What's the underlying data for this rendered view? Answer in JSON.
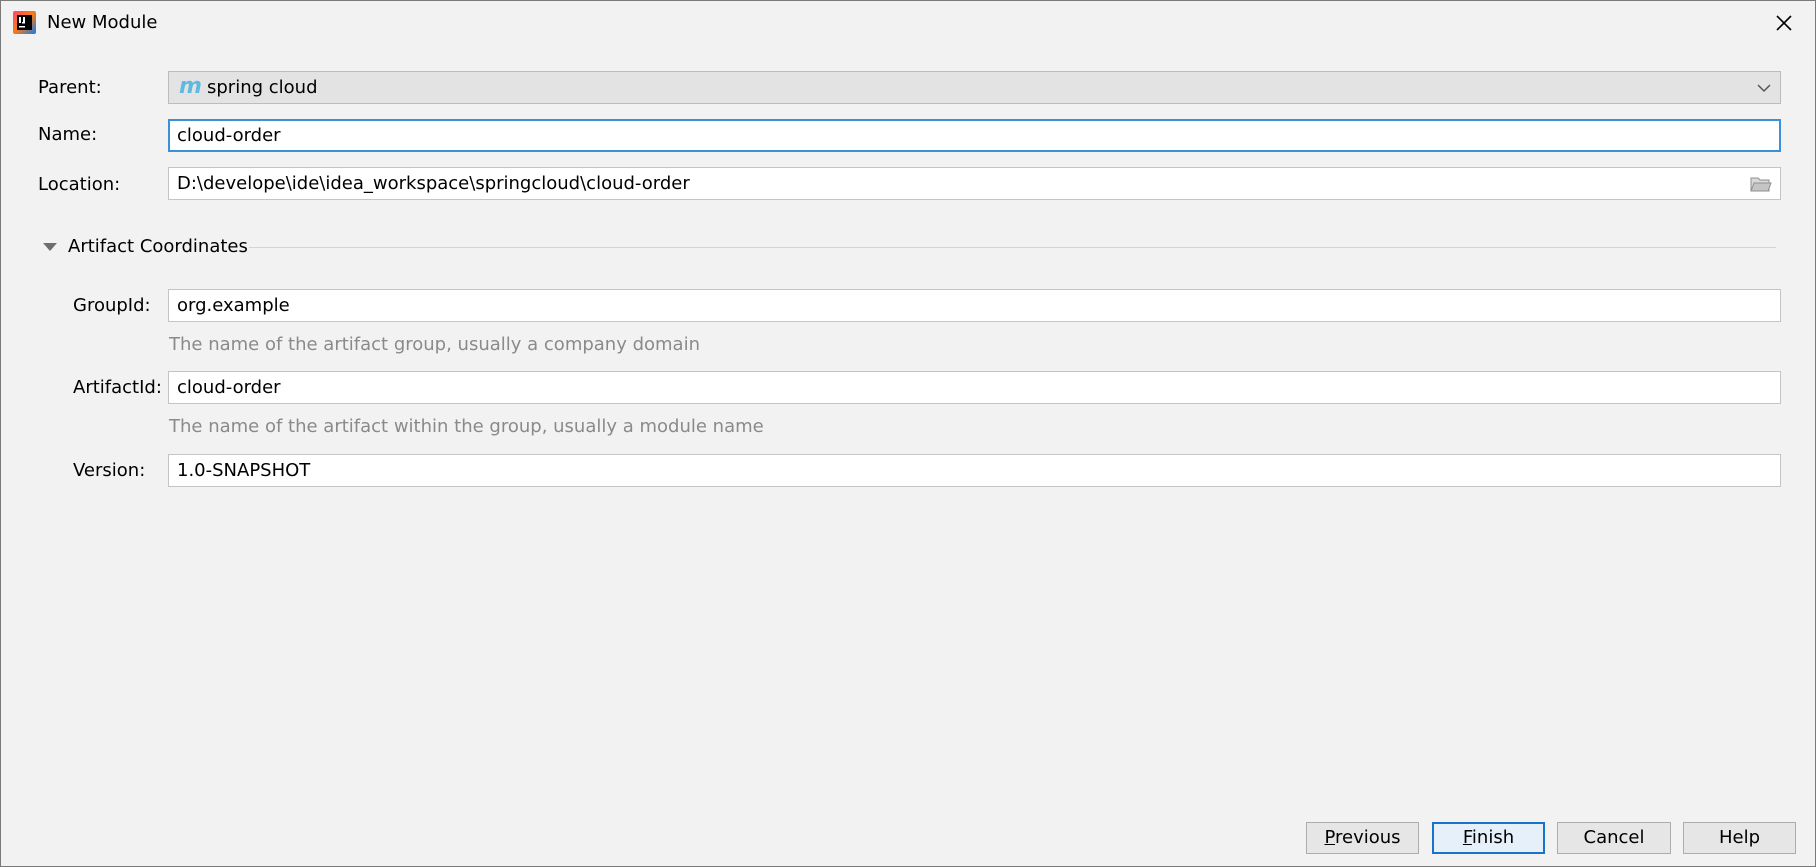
{
  "window": {
    "title": "New Module",
    "app_icon": "intellij-idea-icon",
    "close_icon": "close-icon"
  },
  "form": {
    "parent": {
      "label": "Parent:",
      "value": "spring cloud",
      "icon": "maven-module-icon",
      "icon_glyph": "m"
    },
    "name": {
      "label": "Name:",
      "value": "cloud-order"
    },
    "location": {
      "label": "Location:",
      "value": "D:\\develope\\ide\\idea_workspace\\springcloud\\cloud-order",
      "icon": "folder-browse-icon"
    }
  },
  "artifact": {
    "section_title": "Artifact Coordinates",
    "expanded": true,
    "group_id": {
      "label": "GroupId:",
      "value": "org.example",
      "hint": "The name of the artifact group, usually a company domain"
    },
    "artifact_id": {
      "label": "ArtifactId:",
      "value": "cloud-order",
      "hint": "The name of the artifact within the group, usually a module name"
    },
    "version": {
      "label": "Version:",
      "value": "1.0-SNAPSHOT"
    }
  },
  "buttons": {
    "previous": {
      "mnemonic": "P",
      "rest": "revious"
    },
    "finish": {
      "mnemonic": "F",
      "rest": "inish"
    },
    "cancel": "Cancel",
    "help": "Help"
  },
  "colors": {
    "background": "#f2f2f2",
    "focus_border": "#3d8fd6",
    "default_button_border": "#1b73c9",
    "hint_text": "#8a8a8a",
    "maven_icon": "#5fb9e0"
  }
}
